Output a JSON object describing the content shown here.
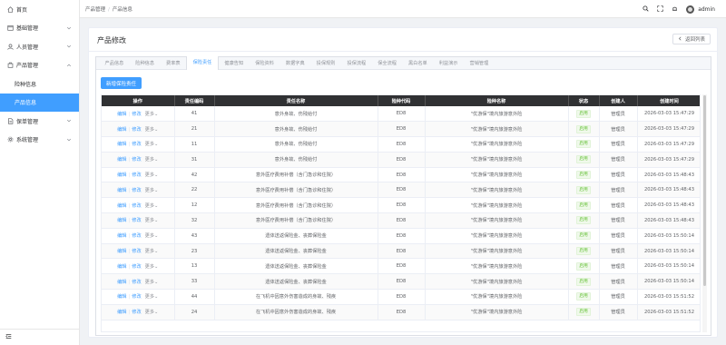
{
  "sidebar": {
    "items": [
      {
        "label": "首页",
        "icon": "home-icon"
      },
      {
        "label": "基础管理",
        "icon": "box-icon"
      },
      {
        "label": "人员管理",
        "icon": "user-icon"
      },
      {
        "label": "产品管理",
        "icon": "product-icon"
      },
      {
        "label": "险种信息",
        "sub": true
      },
      {
        "label": "产品信息",
        "sub": true,
        "active": true
      },
      {
        "label": "保单管理",
        "icon": "policy-icon"
      },
      {
        "label": "系统管理",
        "icon": "gear-icon"
      }
    ]
  },
  "header": {
    "breadcrumb": [
      "产品管理",
      "产品信息"
    ],
    "username": "admin"
  },
  "card": {
    "title": "产品修改",
    "back_label": "返回列表"
  },
  "tabs": [
    "产品信息",
    "险种信息",
    "费率表",
    "保险责任",
    "健康告知",
    "保险资料",
    "数据字典",
    "投保规则",
    "投保流程",
    "保全流程",
    "黑白名单",
    "利益演示",
    "营销管理"
  ],
  "active_tab": 3,
  "add_button": "新增保险责任",
  "table": {
    "headers": [
      "操作",
      "责任编码",
      "责任名称",
      "险种代码",
      "险种名称",
      "状态",
      "创建人",
      "创建时间"
    ],
    "action_edit": "编辑",
    "action_modify": "修改",
    "action_more": "更多⌄",
    "rows": [
      [
        "41",
        "意外身故、伤残给付",
        "ED8",
        "\"优游保\"境内旅游意外险",
        "启用",
        "管理员",
        "2026-03-03 15:47:29"
      ],
      [
        "21",
        "意外身故、伤残给付",
        "ED8",
        "\"优游保\"境内旅游意外险",
        "启用",
        "管理员",
        "2026-03-03 15:47:29"
      ],
      [
        "11",
        "意外身故、伤残给付",
        "ED8",
        "\"优游保\"境内旅游意外险",
        "启用",
        "管理员",
        "2026-03-03 15:47:29"
      ],
      [
        "31",
        "意外身故、伤残给付",
        "ED8",
        "\"优游保\"境内旅游意外险",
        "启用",
        "管理员",
        "2026-03-03 15:47:29"
      ],
      [
        "42",
        "意外医疗费用补偿（含门急诊和住院）",
        "ED8",
        "\"优游保\"境内旅游意外险",
        "启用",
        "管理员",
        "2026-03-03 15:48:43"
      ],
      [
        "22",
        "意外医疗费用补偿（含门急诊和住院）",
        "ED8",
        "\"优游保\"境内旅游意外险",
        "启用",
        "管理员",
        "2026-03-03 15:48:43"
      ],
      [
        "12",
        "意外医疗费用补偿（含门急诊和住院）",
        "ED8",
        "\"优游保\"境内旅游意外险",
        "启用",
        "管理员",
        "2026-03-03 15:48:43"
      ],
      [
        "32",
        "意外医疗费用补偿（含门急诊和住院）",
        "ED8",
        "\"优游保\"境内旅游意外险",
        "启用",
        "管理员",
        "2026-03-03 15:48:43"
      ],
      [
        "43",
        "遗体送返保险金、丧葬保险金",
        "ED8",
        "\"优游保\"境内旅游意外险",
        "启用",
        "管理员",
        "2026-03-03 15:50:14"
      ],
      [
        "23",
        "遗体送返保险金、丧葬保险金",
        "ED8",
        "\"优游保\"境内旅游意外险",
        "启用",
        "管理员",
        "2026-03-03 15:50:14"
      ],
      [
        "13",
        "遗体送返保险金、丧葬保险金",
        "ED8",
        "\"优游保\"境内旅游意外险",
        "启用",
        "管理员",
        "2026-03-03 15:50:14"
      ],
      [
        "33",
        "遗体送返保险金、丧葬保险金",
        "ED8",
        "\"优游保\"境内旅游意外险",
        "启用",
        "管理员",
        "2026-03-03 15:50:14"
      ],
      [
        "44",
        "在飞机中因意外伤害造成的身故、残疾",
        "ED8",
        "\"优游保\"境内旅游意外险",
        "启用",
        "管理员",
        "2026-03-03 15:51:52"
      ],
      [
        "24",
        "在飞机中因意外伤害造成的身故、残疾",
        "ED8",
        "\"优游保\"境内旅游意外险",
        "启用",
        "管理员",
        "2026-03-03 15:51:52"
      ]
    ]
  },
  "colors": {
    "primary": "#409eff",
    "header_bg": "#303133",
    "success": "#67c23a"
  }
}
